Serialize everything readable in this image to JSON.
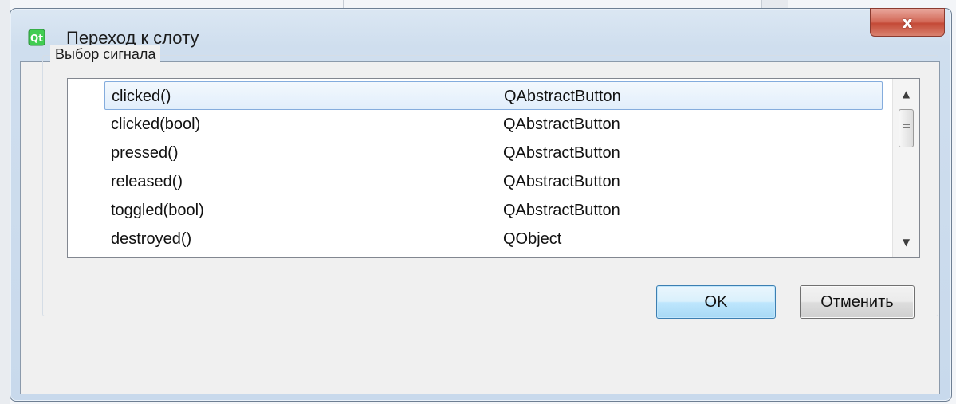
{
  "dialog": {
    "title": "Переход к слоту",
    "icon": "qt-creator-icon",
    "close_label": "x"
  },
  "group": {
    "label": "Выбор сигнала"
  },
  "signals": [
    {
      "signal": "clicked()",
      "class": "QAbstractButton",
      "selected": true
    },
    {
      "signal": "clicked(bool)",
      "class": "QAbstractButton",
      "selected": false
    },
    {
      "signal": "pressed()",
      "class": "QAbstractButton",
      "selected": false
    },
    {
      "signal": "released()",
      "class": "QAbstractButton",
      "selected": false
    },
    {
      "signal": "toggled(bool)",
      "class": "QAbstractButton",
      "selected": false
    },
    {
      "signal": "destroyed()",
      "class": "QObject",
      "selected": false
    }
  ],
  "buttons": {
    "ok_label": "OK",
    "cancel_label": "Отменить"
  },
  "colors": {
    "selection_border": "#84acdd",
    "ok_border": "#3c7fb1",
    "close_red": "#c44a37"
  }
}
